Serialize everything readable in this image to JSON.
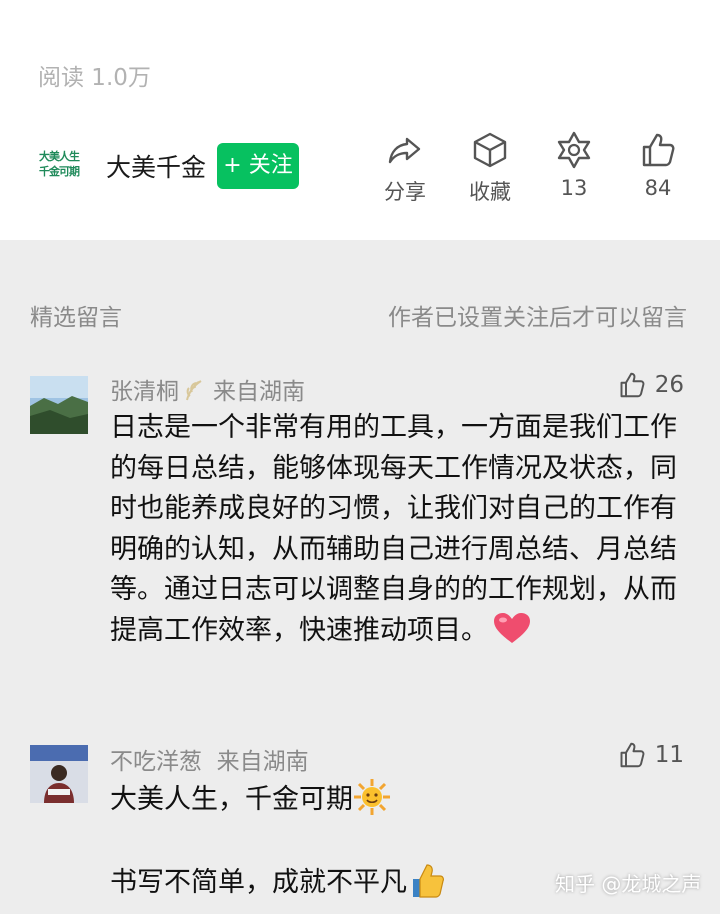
{
  "article": {
    "read_count": "阅读 1.0万",
    "author": {
      "logo_text": "大美人生千金可期",
      "name": "大美千金",
      "follow_label": "+ 关注"
    },
    "actions": [
      {
        "icon": "share-icon",
        "label": "分享"
      },
      {
        "icon": "collect-icon",
        "label": "收藏"
      },
      {
        "icon": "star-icon",
        "label": "13"
      },
      {
        "icon": "thumb-up-icon",
        "label": "84"
      }
    ]
  },
  "comments_section": {
    "title": "精选留言",
    "notice": "作者已设置关注后才可以留言",
    "comments": [
      {
        "user": "张清桐",
        "location": "来自湖南",
        "likes": "26",
        "text": "日志是一个非常有用的工具，一方面是我们工作的每日总结，能够体现每天工作情况及状态，同时也能养成良好的习惯，让我们对自己的工作有明确的认知，从而辅助自己进行周总结、月总结等。通过日志可以调整自身的的工作规划，从而提高工作效率，快速推动项目。"
      },
      {
        "user": "不吃洋葱",
        "location": "来自湖南",
        "likes": "11",
        "line1": "大美人生，千金可期",
        "line2": "书写不简单，成就不平凡"
      }
    ]
  },
  "watermark": "知乎 @龙城之声",
  "colors": {
    "accent": "#07c160",
    "muted_text": "#8a8a8a",
    "background": "#ededed"
  }
}
